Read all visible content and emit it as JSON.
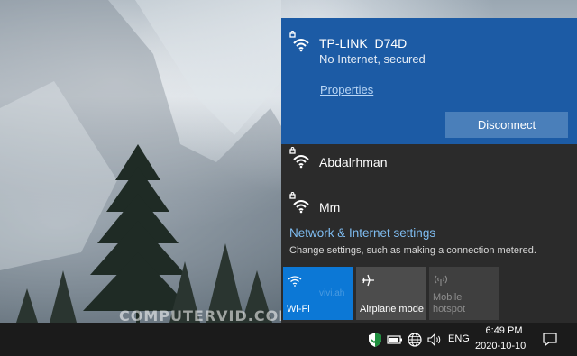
{
  "desktop": {
    "watermark": "COMPUTERVID.COM"
  },
  "flyout": {
    "connected_network": {
      "name": "TP-LINK_D74D",
      "status": "No Internet, secured",
      "properties_label": "Properties",
      "disconnect_label": "Disconnect",
      "icon": "wifi-secured-icon"
    },
    "networks": [
      {
        "name": "Abdalrhman",
        "icon": "wifi-secured-icon"
      },
      {
        "name": "Mm",
        "icon": "wifi-secured-icon"
      }
    ],
    "settings": {
      "title": "Network & Internet settings",
      "description": "Change settings, such as making a connection metered."
    },
    "quick_actions": [
      {
        "label": "Wi-Fi",
        "icon": "wifi-icon",
        "state": "on"
      },
      {
        "label": "Airplane mode",
        "icon": "airplane-icon",
        "state": "off"
      },
      {
        "label": "Mobile hotspot",
        "icon": "hotspot-icon",
        "state": "disabled"
      }
    ],
    "tile_watermark": "vivi.ah",
    "colors": {
      "connected_bg": "#1c5ba5",
      "flyout_bg": "#2b2b2b",
      "accent": "#0c78d6",
      "link": "#7fbdf2"
    }
  },
  "taskbar": {
    "language": "ENG",
    "time": "6:49 PM",
    "date": "2020-10-10",
    "tray_icons": [
      "shield-icon",
      "battery-icon",
      "globe-icon",
      "volume-icon"
    ],
    "notification_icon": "notification-icon"
  }
}
